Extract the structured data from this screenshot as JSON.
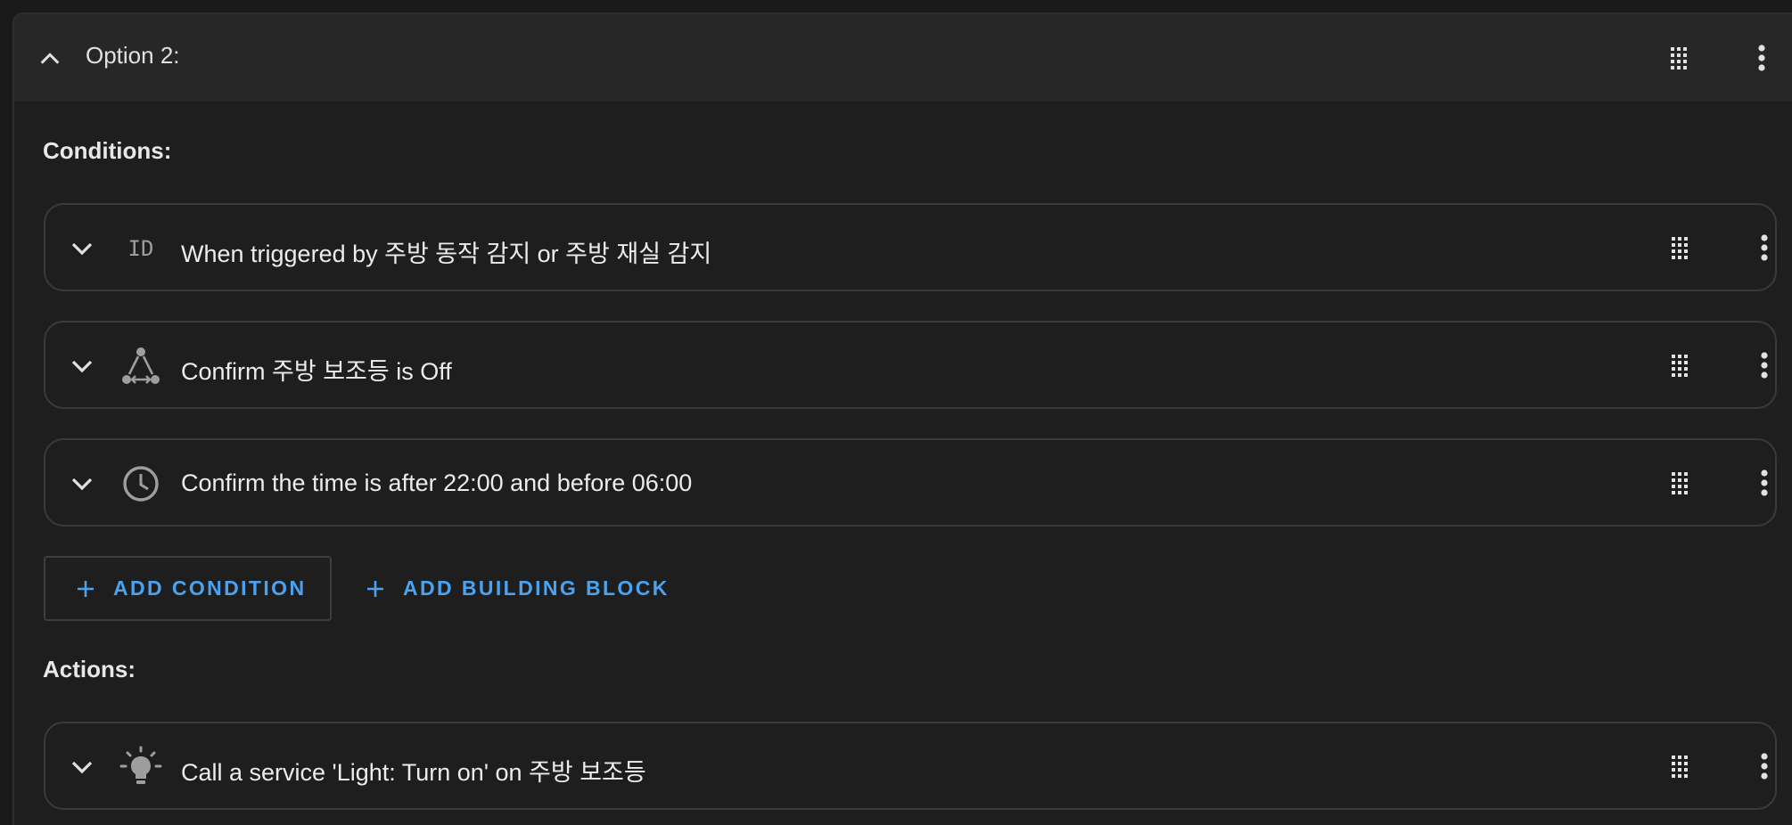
{
  "option": {
    "title": "Option 2:"
  },
  "conditions": {
    "label": "Conditions:",
    "items": [
      {
        "icon": "id-badge-icon",
        "icon_text": "ID",
        "text": "When triggered by 주방 동작 감지 or 주방 재실 감지"
      },
      {
        "icon": "device-network-icon",
        "text": "Confirm 주방 보조등 is Off"
      },
      {
        "icon": "clock-icon",
        "text": "Confirm the time is after 22:00 and before 06:00"
      }
    ]
  },
  "buttons": {
    "add_condition": "ADD CONDITION",
    "add_building_block": "ADD BUILDING BLOCK"
  },
  "actions": {
    "label": "Actions:",
    "items": [
      {
        "icon": "lightbulb-icon",
        "text": "Call a service 'Light: Turn on' on 주방 보조등"
      }
    ]
  },
  "colors": {
    "accent": "#4aa3f0",
    "background": "#1e1e1e",
    "header": "#272727",
    "border": "#3a3a3a",
    "icon": "#9e9e9e"
  }
}
